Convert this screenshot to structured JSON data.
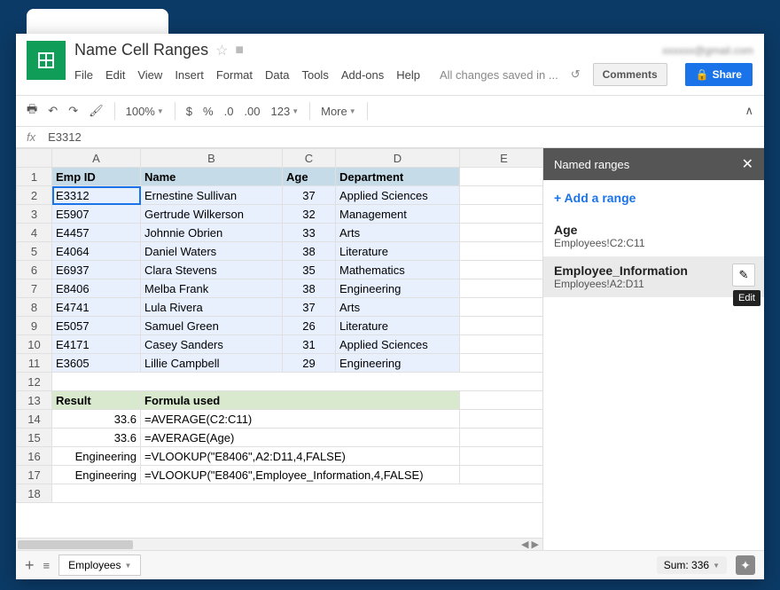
{
  "doc": {
    "title": "Name Cell Ranges",
    "saved_msg": "All changes saved in ...",
    "user_email": "xxxxxx@gmail.com"
  },
  "menu": {
    "file": "File",
    "edit": "Edit",
    "view": "View",
    "insert": "Insert",
    "format": "Format",
    "data": "Data",
    "tools": "Tools",
    "addons": "Add-ons",
    "help": "Help"
  },
  "buttons": {
    "comments": "Comments",
    "share": "Share"
  },
  "toolbar": {
    "zoom": "100%",
    "dollar": "$",
    "percent": "%",
    "dec0": ".0",
    "dec00": ".00",
    "fmt123": "123",
    "more": "More"
  },
  "fx": {
    "label": "fx",
    "value": "E3312"
  },
  "columns": {
    "A": "A",
    "B": "B",
    "C": "C",
    "D": "D",
    "E": "E"
  },
  "headers": {
    "empid": "Emp ID",
    "name": "Name",
    "age": "Age",
    "department": "Department"
  },
  "rows": [
    {
      "id": "E3312",
      "name": "Ernestine Sullivan",
      "age": 37,
      "dept": "Applied Sciences"
    },
    {
      "id": "E5907",
      "name": "Gertrude Wilkerson",
      "age": 32,
      "dept": "Management"
    },
    {
      "id": "E4457",
      "name": "Johnnie Obrien",
      "age": 33,
      "dept": "Arts"
    },
    {
      "id": "E4064",
      "name": "Daniel Waters",
      "age": 38,
      "dept": "Literature"
    },
    {
      "id": "E6937",
      "name": "Clara Stevens",
      "age": 35,
      "dept": "Mathematics"
    },
    {
      "id": "E8406",
      "name": "Melba Frank",
      "age": 38,
      "dept": "Engineering"
    },
    {
      "id": "E4741",
      "name": "Lula Rivera",
      "age": 37,
      "dept": "Arts"
    },
    {
      "id": "E5057",
      "name": "Samuel Green",
      "age": 26,
      "dept": "Literature"
    },
    {
      "id": "E4171",
      "name": "Casey Sanders",
      "age": 31,
      "dept": "Applied Sciences"
    },
    {
      "id": "E3605",
      "name": "Lillie Campbell",
      "age": 29,
      "dept": "Engineering"
    }
  ],
  "result_hdr": {
    "result": "Result",
    "formula": "Formula used"
  },
  "results": [
    {
      "result": "33.6",
      "formula": "=AVERAGE(C2:C11)"
    },
    {
      "result": "33.6",
      "formula": "=AVERAGE(Age)"
    },
    {
      "result": "Engineering",
      "formula": "=VLOOKUP(\"E8406\",A2:D11,4,FALSE)"
    },
    {
      "result": "Engineering",
      "formula": "=VLOOKUP(\"E8406\",Employee_Information,4,FALSE)"
    }
  ],
  "sheet_tab": {
    "name": "Employees"
  },
  "sum": {
    "label": "Sum: 336"
  },
  "sidepanel": {
    "title": "Named ranges",
    "add": "+ Add a range",
    "ranges": [
      {
        "name": "Age",
        "ref": "Employees!C2:C11"
      },
      {
        "name": "Employee_Information",
        "ref": "Employees!A2:D11"
      }
    ],
    "edit_tip": "Edit"
  }
}
